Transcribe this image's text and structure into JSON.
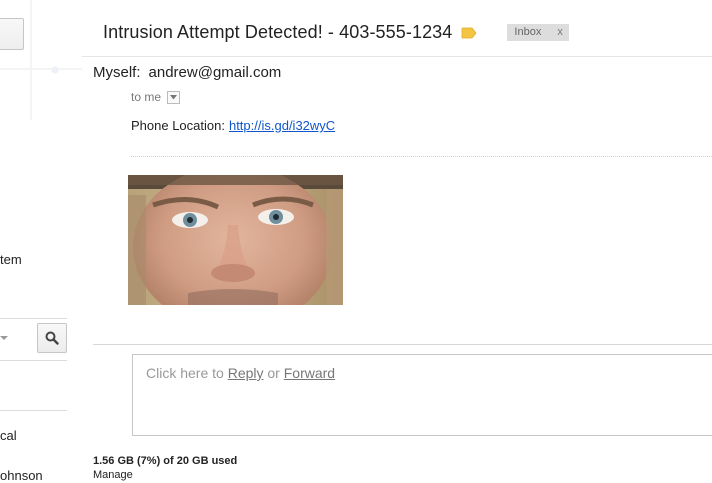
{
  "sidebar": {
    "item_partial_1": "tem",
    "item_partial_2": "cal",
    "item_partial_3": "ohnson"
  },
  "message": {
    "subject": "Intrusion Attempt Detected! - 403-555-1234",
    "label": "Inbox",
    "label_remove": "x",
    "from_name": "Myself:",
    "from_email": "andrew@gmail.com",
    "to": "to me",
    "body_prefix": "Phone Location:",
    "link_text": "http://is.gd/i32wyC"
  },
  "reply": {
    "prefix": "Click here to",
    "reply_label": "Reply",
    "or": "or",
    "forward_label": "Forward"
  },
  "footer": {
    "storage": "1.56 GB (7%) of 20 GB used",
    "manage": "Manage"
  },
  "colors": {
    "link": "#1155cc",
    "tag": "#f4c542",
    "chip_bg": "#dddddd"
  }
}
